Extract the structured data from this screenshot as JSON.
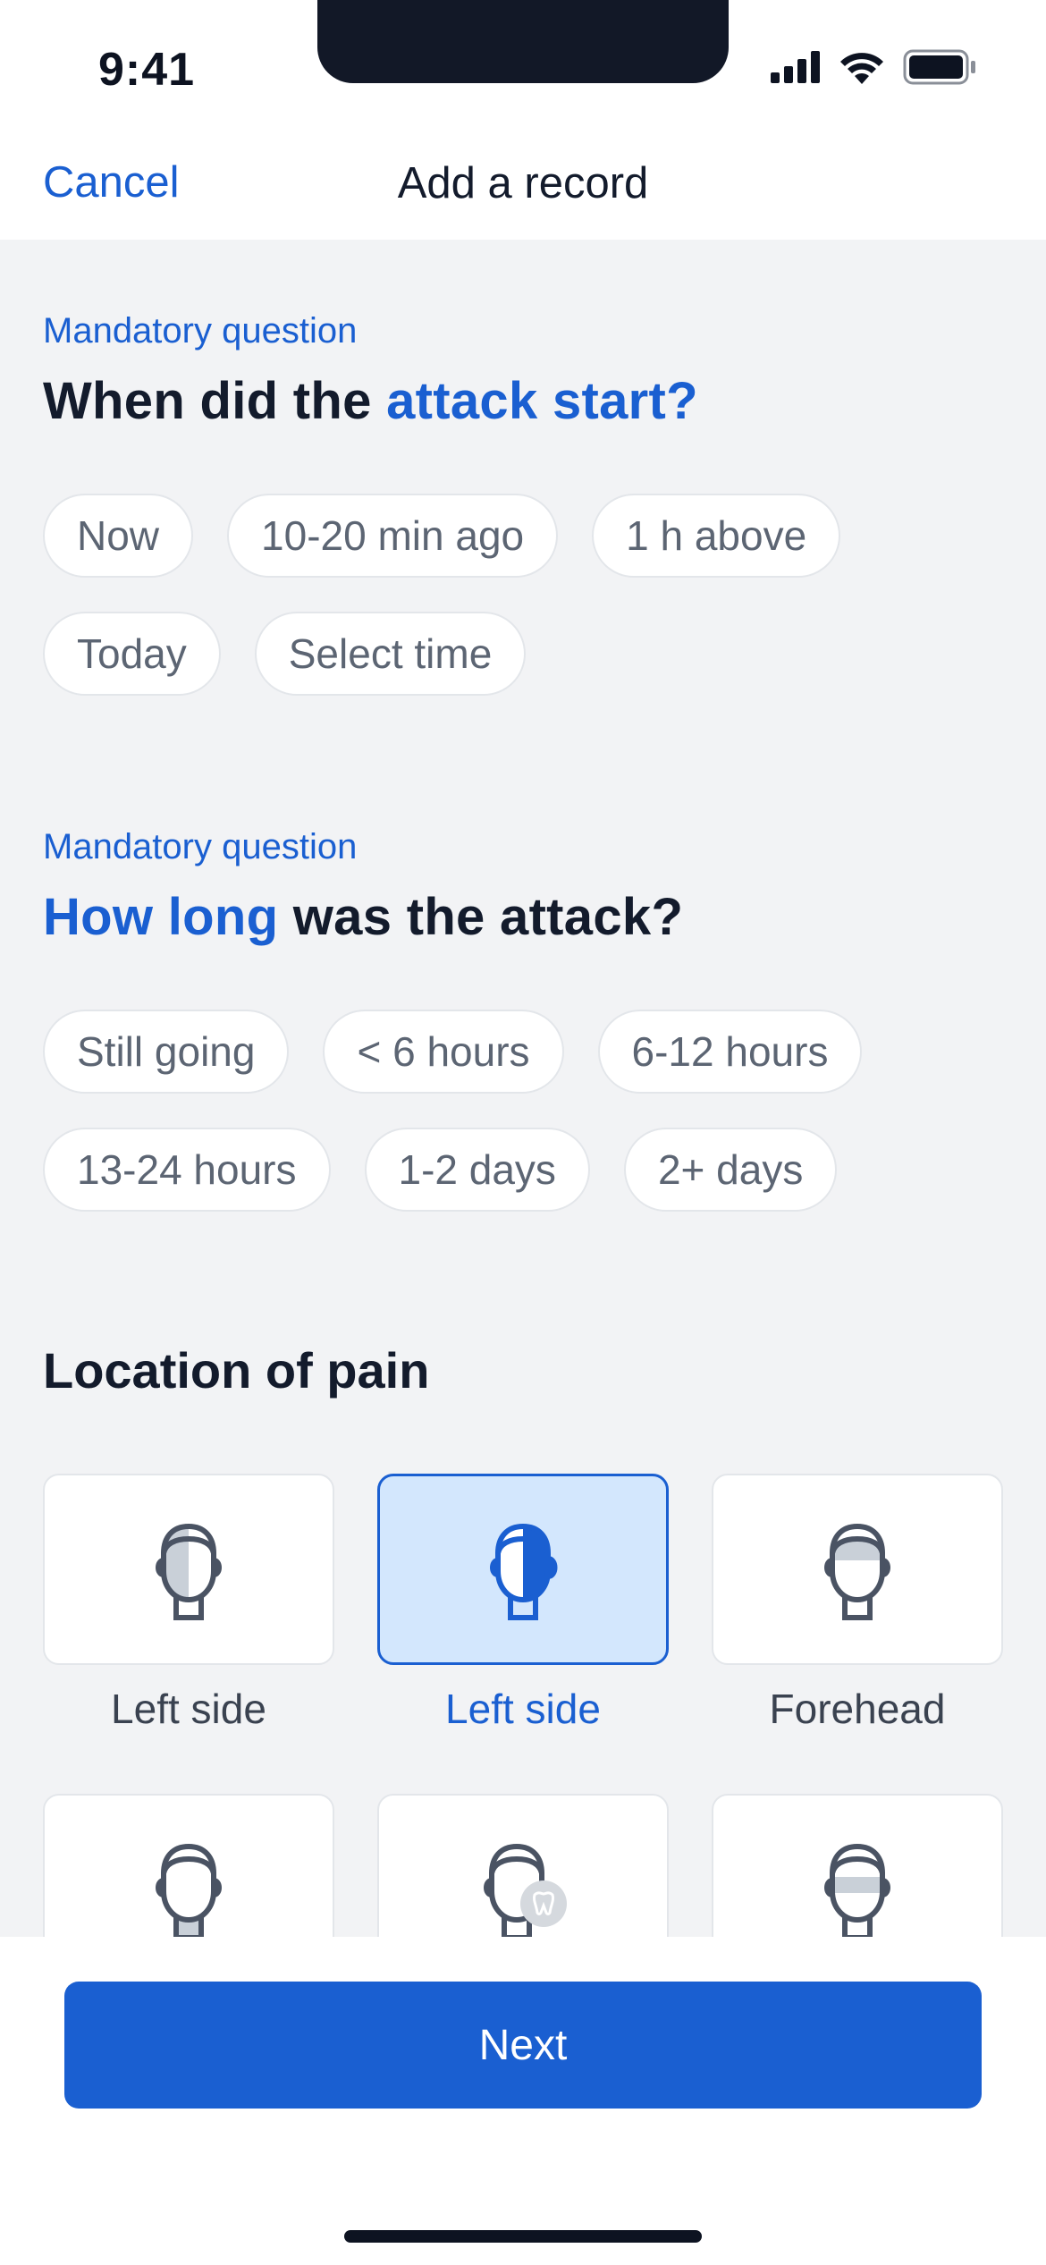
{
  "status": {
    "time": "9:41"
  },
  "nav": {
    "cancel": "Cancel",
    "title": "Add a record"
  },
  "q1": {
    "mandatory": "Mandatory question",
    "prefix": "When did the ",
    "highlight": "attack start?",
    "options": [
      "Now",
      "10-20 min ago",
      "1 h above",
      "Today",
      "Select time"
    ]
  },
  "q2": {
    "mandatory": "Mandatory question",
    "highlight": "How long",
    "suffix": " was the attack?",
    "options": [
      "Still going",
      "< 6 hours",
      "6-12 hours",
      "13-24 hours",
      "1-2 days",
      "2+ days"
    ]
  },
  "location": {
    "title": "Location of pain",
    "items": [
      {
        "label": "Left side",
        "icon": "head-left-side-icon",
        "selected": false
      },
      {
        "label": "Left side",
        "icon": "head-left-side-icon",
        "selected": true
      },
      {
        "label": "Forehead",
        "icon": "head-forehead-icon",
        "selected": false
      },
      {
        "label": "",
        "icon": "head-neck-icon",
        "selected": false
      },
      {
        "label": "",
        "icon": "head-tooth-icon",
        "selected": false
      },
      {
        "label": "",
        "icon": "head-eyes-icon",
        "selected": false
      }
    ]
  },
  "footer": {
    "next": "Next"
  },
  "colors": {
    "accent": "#1a5fd1",
    "selected_bg": "#d3e7fd",
    "background": "#f2f3f5"
  }
}
